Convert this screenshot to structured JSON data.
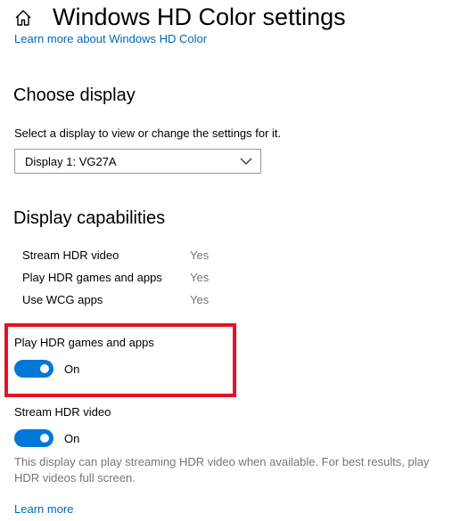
{
  "header": {
    "title": "Windows HD Color settings",
    "home_icon": "home-icon",
    "learn_more_link": "Learn more about Windows HD Color"
  },
  "choose_display": {
    "heading": "Choose display",
    "description": "Select a display to view or change the settings for it.",
    "selected_display": "Display 1: VG27A",
    "dropdown_icon": "chevron-down-icon"
  },
  "capabilities": {
    "heading": "Display capabilities",
    "items": [
      {
        "label": "Stream HDR video",
        "value": "Yes"
      },
      {
        "label": "Play HDR games and apps",
        "value": "Yes"
      },
      {
        "label": "Use WCG apps",
        "value": "Yes"
      }
    ]
  },
  "play_hdr": {
    "label": "Play HDR games and apps",
    "state": "On",
    "highlight_color": "#e81123"
  },
  "stream_hdr": {
    "label": "Stream HDR video",
    "state": "On",
    "description": "This display can play streaming HDR video when available. For best results, play HDR videos full screen.",
    "learn_more": "Learn more"
  },
  "colors": {
    "accent": "#0078d7",
    "link": "#0067b8",
    "secondary_text": "#767676"
  }
}
